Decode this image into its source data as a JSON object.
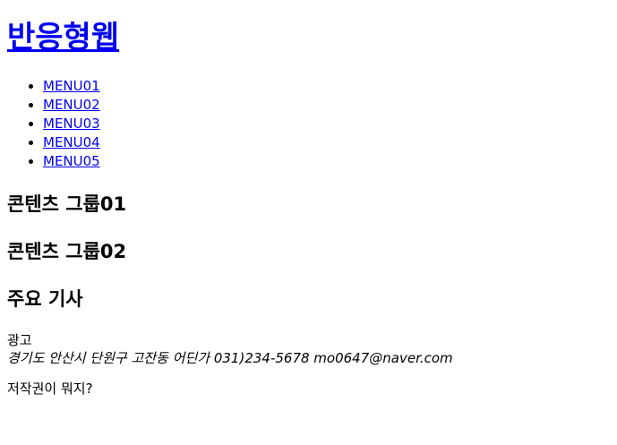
{
  "header": {
    "title": "반응형웹"
  },
  "nav": {
    "items": [
      {
        "label": "MENU01"
      },
      {
        "label": "MENU02"
      },
      {
        "label": "MENU03"
      },
      {
        "label": "MENU04"
      },
      {
        "label": "MENU05"
      }
    ]
  },
  "sections": {
    "group01": "콘텐츠 그룹01",
    "group02": "콘텐츠 그룹02",
    "main_articles": "주요 기사"
  },
  "aside": {
    "ad_label": "광고"
  },
  "footer": {
    "address": "경기도 안산시 단원구 고잔동 어딘가 031)234-5678 mo0647@naver.com",
    "copyright": "저작권이 뭐지?"
  }
}
